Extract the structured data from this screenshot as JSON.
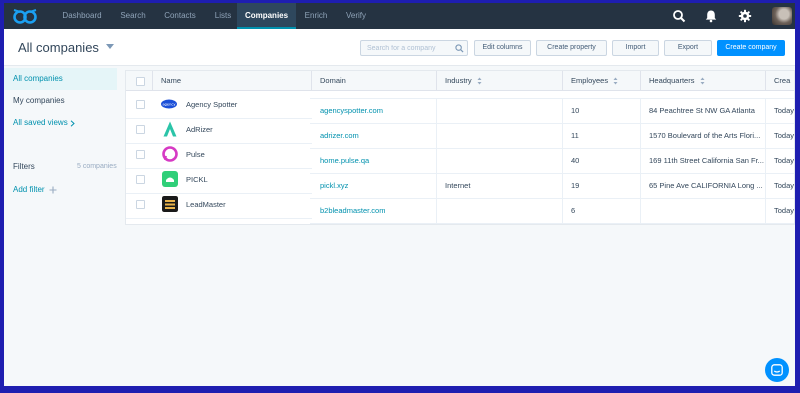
{
  "nav": {
    "tabs": [
      "Dashboard",
      "Search",
      "Contacts",
      "Lists",
      "Companies",
      "Enrich",
      "Verify"
    ],
    "active": "Companies",
    "icons": [
      "search-icon",
      "bell-icon",
      "gear-icon"
    ]
  },
  "header": {
    "title": "All companies",
    "search_placeholder": "Search for a company",
    "buttons": {
      "edit_columns": "Edit columns",
      "create_property": "Create property",
      "import": "Import",
      "export": "Export",
      "create_company": "Create company"
    }
  },
  "sidebar": {
    "all_companies": "All companies",
    "my_companies": "My companies",
    "saved_views": "All saved views",
    "filters": "Filters",
    "filter_count": "5 companies",
    "add_filter": "Add filter"
  },
  "table": {
    "columns": [
      "Name",
      "Domain",
      "Industry",
      "Employees",
      "Headquarters",
      "Crea"
    ],
    "rows": [
      {
        "name": "Agency Spotter",
        "domain": "agencyspotter.com",
        "industry": "",
        "employees": "10",
        "hq": "84 Peachtree St NW GA Atlanta",
        "created": "Today"
      },
      {
        "name": "AdRizer",
        "domain": "adrizer.com",
        "industry": "",
        "employees": "11",
        "hq": "1570 Boulevard of the Arts Flori...",
        "created": "Today"
      },
      {
        "name": "Pulse",
        "domain": "home.pulse.qa",
        "industry": "",
        "employees": "40",
        "hq": "169 11th Street California San Fr...",
        "created": "Today"
      },
      {
        "name": "PICKL",
        "domain": "pickl.xyz",
        "industry": "Internet",
        "employees": "19",
        "hq": "65 Pine Ave CALIFORNIA Long ...",
        "created": "Today"
      },
      {
        "name": "LeadMaster",
        "domain": "b2bleadmaster.com",
        "industry": "",
        "employees": "6",
        "hq": "",
        "created": "Today"
      }
    ]
  },
  "colors": {
    "nav_bg": "#253342",
    "accent": "#0091ae",
    "primary_button": "#0091ff",
    "frame_border": "#1e1eb0"
  }
}
